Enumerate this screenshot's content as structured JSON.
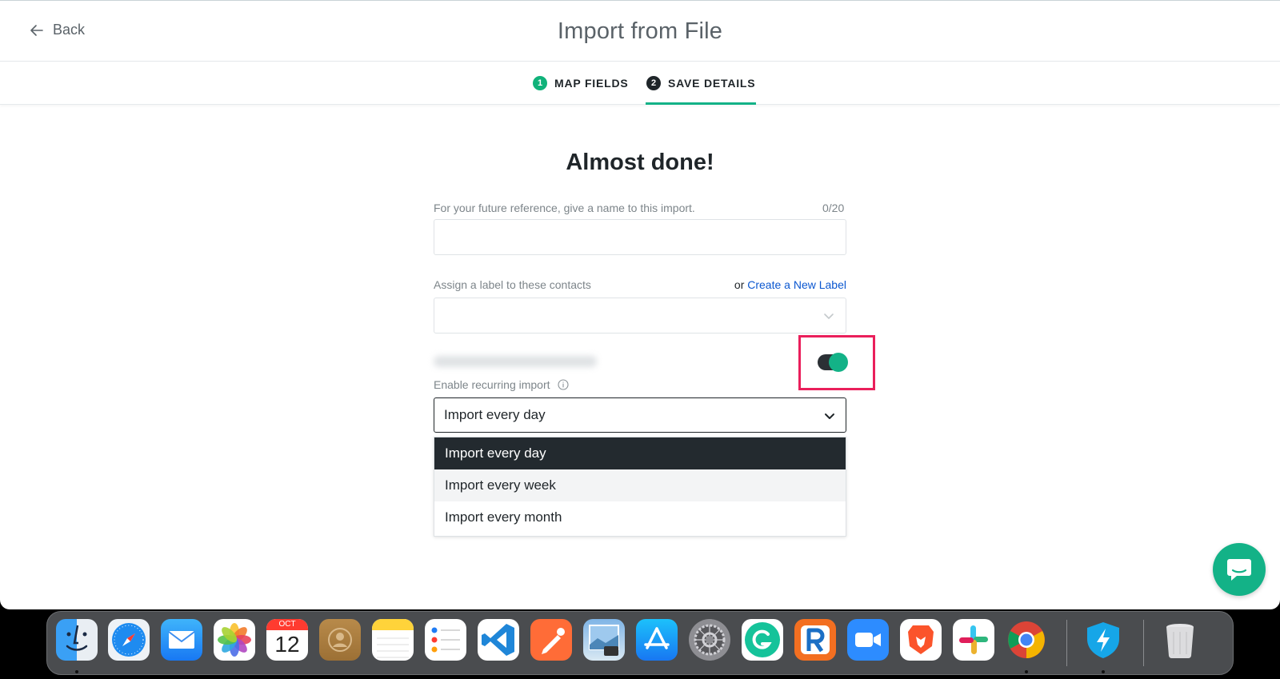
{
  "header": {
    "back_label": "Back",
    "title": "Import from File"
  },
  "steps": [
    {
      "number": "1",
      "label": "MAP FIELDS"
    },
    {
      "number": "2",
      "label": "SAVE DETAILS",
      "active": true
    }
  ],
  "form": {
    "headline": "Almost done!",
    "name_label": "For your future reference, give a name to this import.",
    "name_counter": "0/20",
    "name_value": "",
    "label_label": "Assign a label to these contacts",
    "or_text": "or",
    "create_label_link": "Create a New Label",
    "label_value": "",
    "toggle_on": true,
    "recurring_label": "Enable recurring import",
    "recurring_selected": "Import every day",
    "recurring_options": [
      "Import every day",
      "Import every week",
      "Import every month"
    ]
  },
  "colors": {
    "accent": "#13b287",
    "highlight": "#ea1f5b",
    "link": "#0b57d0"
  },
  "dock": {
    "apps": [
      "finder-icon",
      "safari-icon",
      "mail-icon",
      "photos-icon",
      "calendar-icon",
      "contacts-icon",
      "notes-icon",
      "reminders-icon",
      "vscode-icon",
      "postman-icon",
      "preview-icon",
      "app-store-icon",
      "system-settings-icon",
      "grammarly-icon",
      "rocket-icon",
      "zoom-icon",
      "brave-icon",
      "slack-icon",
      "chrome-icon",
      "vpn-shield-icon",
      "trash-icon"
    ],
    "calendar_month": "OCT",
    "calendar_day": "12"
  }
}
